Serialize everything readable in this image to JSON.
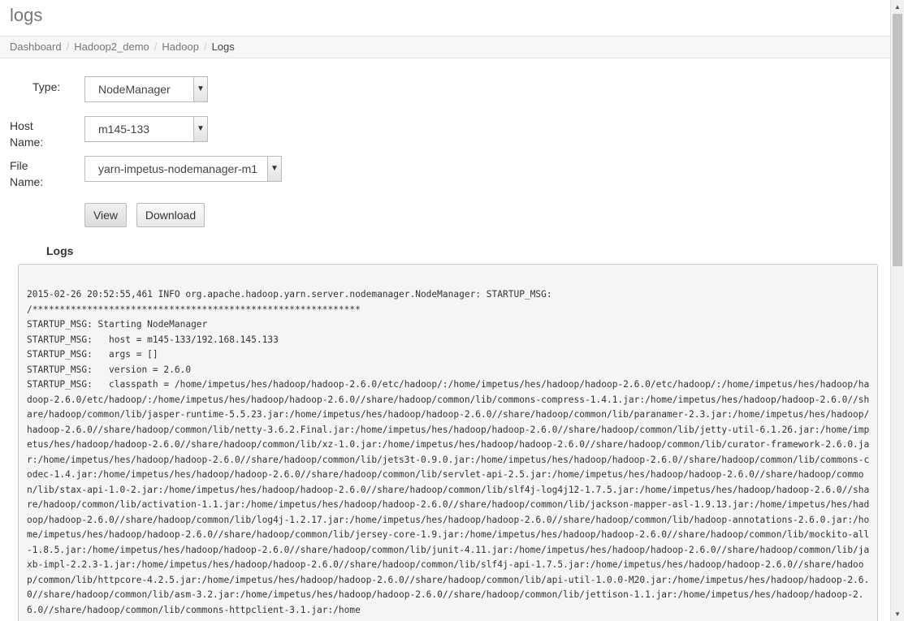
{
  "page": {
    "title": "logs"
  },
  "breadcrumb": {
    "items": [
      "Dashboard",
      "Hadoop2_demo",
      "Hadoop"
    ],
    "current": "Logs",
    "separator": "/"
  },
  "form": {
    "type_label": "Type:",
    "type_value": "NodeManager",
    "host_label": "Host Name:",
    "host_value": "m145-133",
    "file_label": "File Name:",
    "file_value": "yarn-impetus-nodemanager-m1"
  },
  "buttons": {
    "view": "View",
    "download": "Download"
  },
  "logs": {
    "heading": "Logs",
    "lines": [
      "2015-02-26 20:52:55,461 INFO org.apache.hadoop.yarn.server.nodemanager.NodeManager: STARTUP_MSG:",
      "/************************************************************",
      "STARTUP_MSG: Starting NodeManager",
      "STARTUP_MSG:   host = m145-133/192.168.145.133",
      "STARTUP_MSG:   args = []",
      "STARTUP_MSG:   version = 2.6.0",
      "STARTUP_MSG:   classpath = /home/impetus/hes/hadoop/hadoop-2.6.0/etc/hadoop/:/home/impetus/hes/hadoop/hadoop-2.6.0/etc/hadoop/:/home/impetus/hes/hadoop/hadoop-2.6.0/etc/hadoop/:/home/impetus/hes/hadoop/hadoop-2.6.0//share/hadoop/common/lib/commons-compress-1.4.1.jar:/home/impetus/hes/hadoop/hadoop-2.6.0//share/hadoop/common/lib/jasper-runtime-5.5.23.jar:/home/impetus/hes/hadoop/hadoop-2.6.0//share/hadoop/common/lib/paranamer-2.3.jar:/home/impetus/hes/hadoop/hadoop-2.6.0//share/hadoop/common/lib/netty-3.6.2.Final.jar:/home/impetus/hes/hadoop/hadoop-2.6.0//share/hadoop/common/lib/jetty-util-6.1.26.jar:/home/impetus/hes/hadoop/hadoop-2.6.0//share/hadoop/common/lib/xz-1.0.jar:/home/impetus/hes/hadoop/hadoop-2.6.0//share/hadoop/common/lib/curator-framework-2.6.0.jar:/home/impetus/hes/hadoop/hadoop-2.6.0//share/hadoop/common/lib/jets3t-0.9.0.jar:/home/impetus/hes/hadoop/hadoop-2.6.0//share/hadoop/common/lib/commons-codec-1.4.jar:/home/impetus/hes/hadoop/hadoop-2.6.0//share/hadoop/common/lib/servlet-api-2.5.jar:/home/impetus/hes/hadoop/hadoop-2.6.0//share/hadoop/common/lib/stax-api-1.0-2.jar:/home/impetus/hes/hadoop/hadoop-2.6.0//share/hadoop/common/lib/slf4j-log4j12-1.7.5.jar:/home/impetus/hes/hadoop/hadoop-2.6.0//share/hadoop/common/lib/activation-1.1.jar:/home/impetus/hes/hadoop/hadoop-2.6.0//share/hadoop/common/lib/jackson-mapper-asl-1.9.13.jar:/home/impetus/hes/hadoop/hadoop-2.6.0//share/hadoop/common/lib/log4j-1.2.17.jar:/home/impetus/hes/hadoop/hadoop-2.6.0//share/hadoop/common/lib/hadoop-annotations-2.6.0.jar:/home/impetus/hes/hadoop/hadoop-2.6.0//share/hadoop/common/lib/jersey-core-1.9.jar:/home/impetus/hes/hadoop/hadoop-2.6.0//share/hadoop/common/lib/mockito-all-1.8.5.jar:/home/impetus/hes/hadoop/hadoop-2.6.0//share/hadoop/common/lib/junit-4.11.jar:/home/impetus/hes/hadoop/hadoop-2.6.0//share/hadoop/common/lib/jaxb-impl-2.2.3-1.jar:/home/impetus/hes/hadoop/hadoop-2.6.0//share/hadoop/common/lib/slf4j-api-1.7.5.jar:/home/impetus/hes/hadoop/hadoop-2.6.0//share/hadoop/common/lib/httpcore-4.2.5.jar:/home/impetus/hes/hadoop/hadoop-2.6.0//share/hadoop/common/lib/api-util-1.0.0-M20.jar:/home/impetus/hes/hadoop/hadoop-2.6.0//share/hadoop/common/lib/asm-3.2.jar:/home/impetus/hes/hadoop/hadoop-2.6.0//share/hadoop/common/lib/jettison-1.1.jar:/home/impetus/hes/hadoop/hadoop-2.6.0//share/hadoop/common/lib/commons-httpclient-3.1.jar:/home"
    ]
  },
  "icons": {
    "dropdown": "chevron-down-icon",
    "scroll_up": "arrow-up-icon",
    "scroll_down": "arrow-down-icon"
  }
}
